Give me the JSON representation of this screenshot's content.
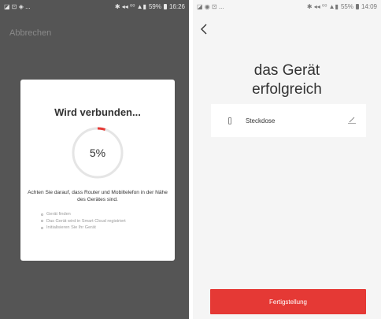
{
  "left_screen": {
    "status_bar": {
      "left_icons": "◪ ⊡ ◈ ...",
      "right_icons": "✱ ◂◂ ⁰⁰ ▲▮",
      "battery": "59%",
      "time": "16:26"
    },
    "cancel_label": "Abbrechen",
    "dialog": {
      "title": "Wird verbunden...",
      "progress_percent": 5,
      "progress_label": "5%",
      "hint": "Achten Sie darauf, dass Router und Mobiltelefon in der Nähe des Gerätes sind.",
      "steps": [
        "Gerät finden",
        "Das Gerät wird in Smart Cloud registriert",
        "Initialisieren Sie Ihr Gerät"
      ]
    },
    "colors": {
      "background": "#555555",
      "progress_track": "#e5e5e5",
      "progress_fill": "#e53935"
    }
  },
  "right_screen": {
    "status_bar": {
      "left_icons": "◪ ◉ ⊡ ...",
      "right_icons": "✱ ◂◂ ⁰⁰ ▲▮",
      "battery": "55%",
      "time": "14:09"
    },
    "back_icon": "chevron-left-icon",
    "title_line1": "das Gerät",
    "title_line2": "erfolgreich",
    "device": {
      "name": "Steckdose",
      "icon": "plug-icon",
      "edit_icon": "pencil-icon"
    },
    "finish_button_label": "Fertigstellung",
    "colors": {
      "background": "#f5f5f5",
      "accent": "#e53935"
    }
  }
}
